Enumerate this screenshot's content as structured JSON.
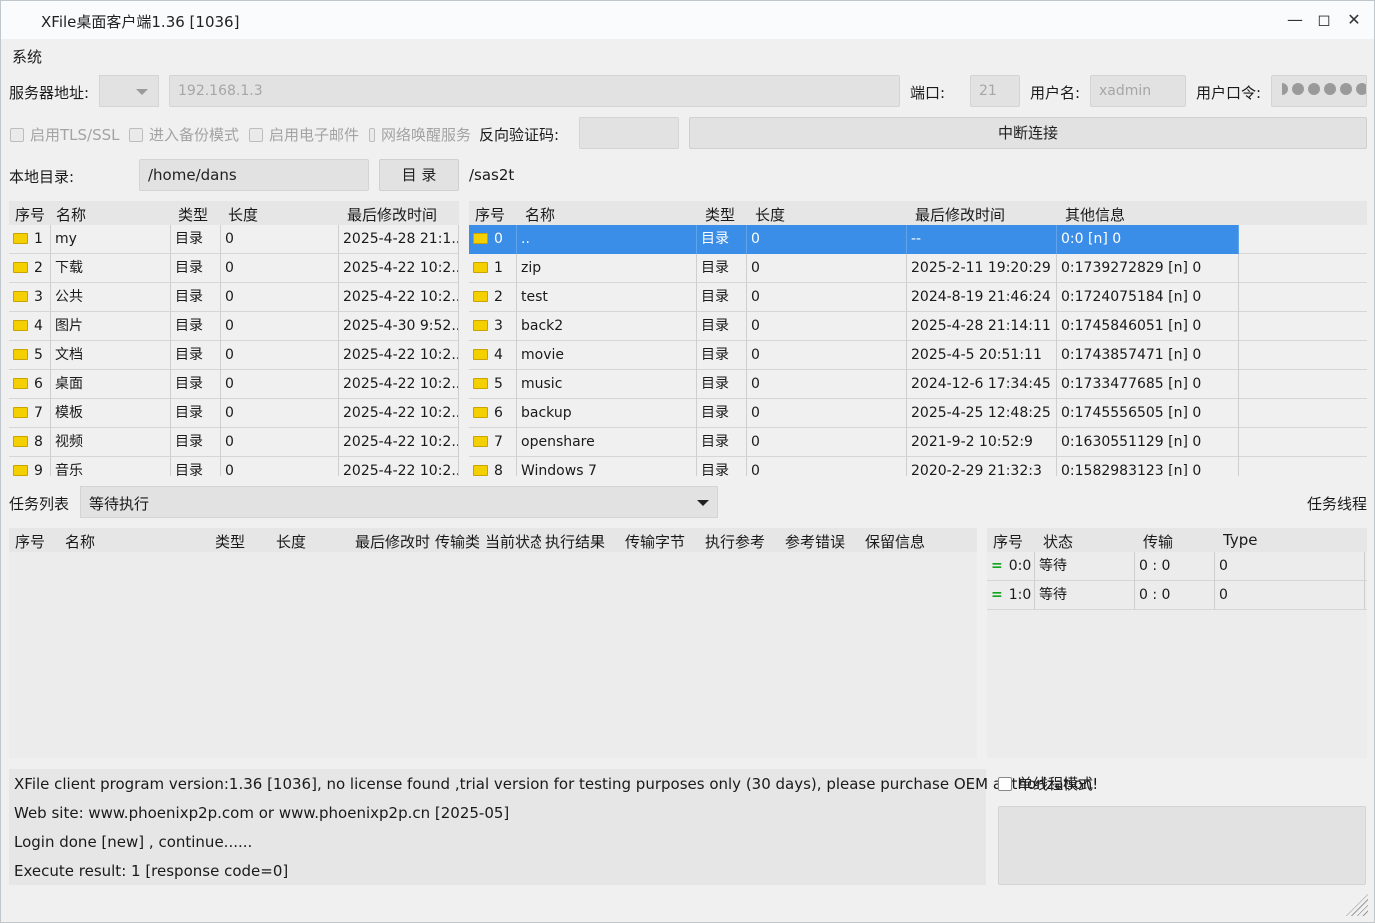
{
  "window": {
    "title": "XFile桌面客户端1.36 [1036]"
  },
  "menu": {
    "system": "系统"
  },
  "conn": {
    "server_label": "服务器地址:",
    "server_value": "192.168.1.3",
    "port_label": "端口:",
    "port_value": "21",
    "user_label": "用户名:",
    "user_value": "xadmin",
    "pass_label": "用户口令:",
    "reverse_label": "反向验证码:",
    "disconnect_btn": "中断连接"
  },
  "options": {
    "tls": "启用TLS/SSL",
    "backup": "进入备份模式",
    "email": "启用电子邮件",
    "wake": "网络唤醒服务"
  },
  "local": {
    "label": "本地目录:",
    "path": "/home/dans",
    "dir_btn": "目 录",
    "remote_path": "/sas2t"
  },
  "local_table": {
    "headers": [
      "序号",
      "名称",
      "类型",
      "长度",
      "最后修改时间"
    ],
    "rows": [
      [
        "1",
        "my",
        "目录",
        "0",
        "2025-4-28 21:1..."
      ],
      [
        "2",
        "下载",
        "目录",
        "0",
        "2025-4-22 10:2..."
      ],
      [
        "3",
        "公共",
        "目录",
        "0",
        "2025-4-22 10:2..."
      ],
      [
        "4",
        "图片",
        "目录",
        "0",
        "2025-4-30 9:52..."
      ],
      [
        "5",
        "文档",
        "目录",
        "0",
        "2025-4-22 10:2..."
      ],
      [
        "6",
        "桌面",
        "目录",
        "0",
        "2025-4-22 10:2..."
      ],
      [
        "7",
        "模板",
        "目录",
        "0",
        "2025-4-22 10:2..."
      ],
      [
        "8",
        "视频",
        "目录",
        "0",
        "2025-4-22 10:2..."
      ],
      [
        "9",
        "音乐",
        "目录",
        "0",
        "2025-4-22 10:2..."
      ]
    ]
  },
  "remote_table": {
    "headers": [
      "序号",
      "名称",
      "类型",
      "长度",
      "最后修改时间",
      "其他信息"
    ],
    "rows": [
      [
        "0",
        "..",
        "目录",
        "0",
        "--",
        "0:0 [n] 0"
      ],
      [
        "1",
        "zip",
        "目录",
        "0",
        "2025-2-11 19:20:29",
        "0:1739272829 [n] 0"
      ],
      [
        "2",
        "test",
        "目录",
        "0",
        "2024-8-19 21:46:24",
        "0:1724075184 [n] 0"
      ],
      [
        "3",
        "back2",
        "目录",
        "0",
        "2025-4-28 21:14:11",
        "0:1745846051 [n] 0"
      ],
      [
        "4",
        "movie",
        "目录",
        "0",
        "2025-4-5 20:51:11",
        "0:1743857471 [n] 0"
      ],
      [
        "5",
        "music",
        "目录",
        "0",
        "2024-12-6 17:34:45",
        "0:1733477685 [n] 0"
      ],
      [
        "6",
        "backup",
        "目录",
        "0",
        "2025-4-25 12:48:25",
        "0:1745556505 [n] 0"
      ],
      [
        "7",
        "openshare",
        "目录",
        "0",
        "2021-9-2 10:52:9",
        "0:1630551129 [n] 0"
      ],
      [
        "8",
        "Windows 7",
        "目录",
        "0",
        "2020-2-29 21:32:3",
        "0:1582983123 [n] 0"
      ]
    ]
  },
  "tasks": {
    "label": "任务列表",
    "filter_value": "等待执行",
    "threads_label": "任务线程",
    "headers": [
      "序号",
      "名称",
      "类型",
      "长度",
      "最后修改时",
      "传输类",
      "当前状态",
      "执行结果",
      "传输字节",
      "执行参考",
      "参考错误",
      "保留信息"
    ]
  },
  "threads_table": {
    "headers": [
      "序号",
      "状态",
      "传输",
      "Type"
    ],
    "rows": [
      [
        "0:0",
        "等待",
        "0 : 0",
        "0"
      ],
      [
        "1:0",
        "等待",
        "0 : 0",
        "0"
      ]
    ]
  },
  "log": [
    "XFile client program version:1.36 [1036], no license found ,trial version for testing purposes only (30 days), please purchase OEM authorization!",
    "Web site: www.phoenixp2p.com or www.phoenixp2p.cn [2025-05]",
    "Login done [new] , continue......",
    "Execute result: 1 [response code=0]"
  ],
  "single_thread": "单线程模式"
}
